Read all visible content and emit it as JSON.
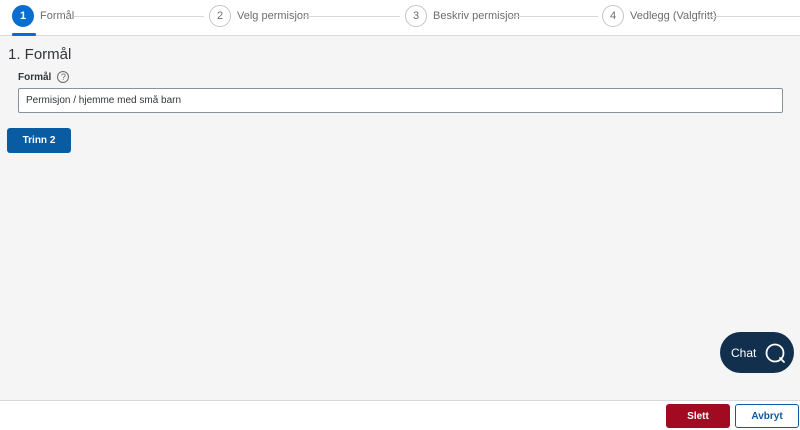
{
  "stepper": {
    "steps": [
      {
        "number": "1",
        "label": "Formål"
      },
      {
        "number": "2",
        "label": "Velg permisjon"
      },
      {
        "number": "3",
        "label": "Beskriv permisjon"
      },
      {
        "number": "4",
        "label": "Vedlegg (Valgfritt)"
      }
    ],
    "active_step": 1
  },
  "section": {
    "title": "1. Formål"
  },
  "form": {
    "purpose_label": "Formål",
    "help_icon": "question-mark-icon",
    "help_glyph": "?",
    "purpose_value": "Permisjon / hjemme med små barn"
  },
  "actions": {
    "next_label": "Trinn 2"
  },
  "chat": {
    "label": "Chat",
    "icon": "chat-bubble-icon"
  },
  "footer": {
    "delete_label": "Slett",
    "cancel_label": "Avbryt"
  },
  "colors": {
    "accent": "#0a6ed1",
    "primary_button": "#0a5ca2",
    "danger": "#a20a22",
    "chat_bg": "#12304d"
  }
}
